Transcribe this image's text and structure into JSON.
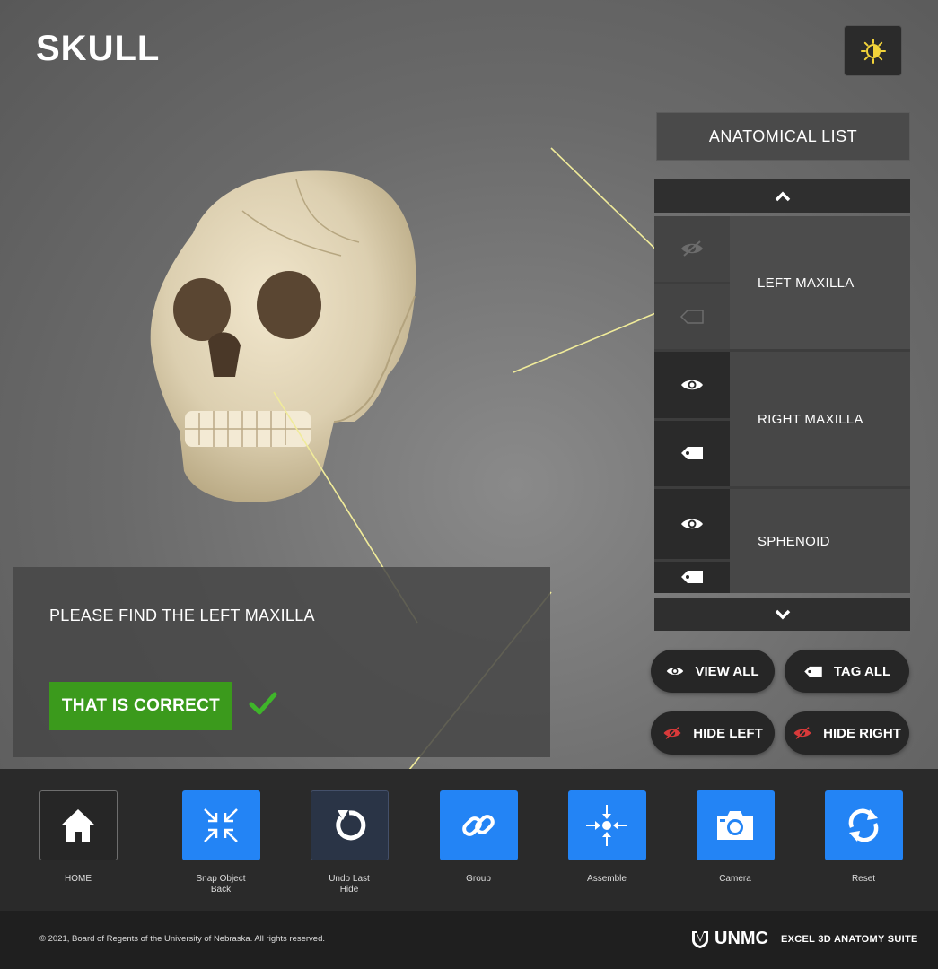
{
  "page": {
    "title": "SKULL"
  },
  "theme_toggle": {
    "icon": "sun-icon"
  },
  "anatomical_list": {
    "title": "ANATOMICAL LIST",
    "scroll_up_icon": "chevron-up-icon",
    "scroll_down_icon": "chevron-down-icon",
    "items": [
      {
        "label": "LEFT MAXILLA",
        "visible": false,
        "tagged": false
      },
      {
        "label": "RIGHT MAXILLA",
        "visible": true,
        "tagged": true
      },
      {
        "label": "SPHENOID",
        "visible": true,
        "tagged": true
      }
    ]
  },
  "actions": {
    "view_all": "VIEW ALL",
    "tag_all": "TAG ALL",
    "hide_left": "HIDE LEFT",
    "hide_right": "HIDE RIGHT"
  },
  "question": {
    "prompt_prefix": "PLEASE FIND THE ",
    "target": "LEFT MAXILLA",
    "result": "THAT IS CORRECT"
  },
  "toolbar": {
    "home": "HOME",
    "snap_back": "Snap Object Back",
    "undo_hide": "Undo Last Hide",
    "group": "Group",
    "assemble": "Assemble",
    "camera": "Camera",
    "reset": "Reset"
  },
  "footer": {
    "copyright": "© 2021, Board of Regents of the University of Nebraska. All rights reserved.",
    "brand": "UNMC",
    "suite": "EXCEL 3D ANATOMY SUITE"
  },
  "colors": {
    "accent_blue": "#2384f5",
    "correct_green": "#3b9a1c",
    "check_green": "#3fb52a",
    "leader_line": "#f0eb9a",
    "hide_red": "#d83a3a"
  }
}
